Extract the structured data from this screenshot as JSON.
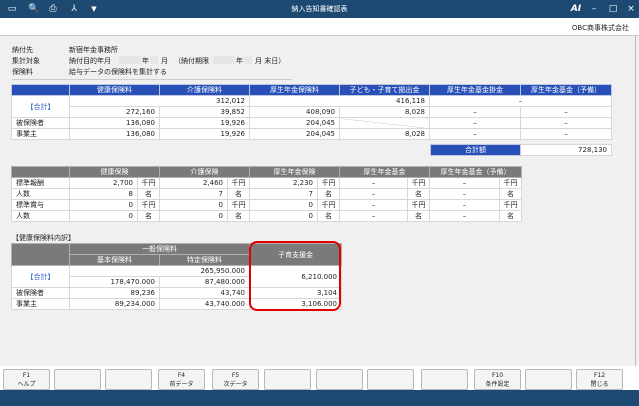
{
  "window": {
    "title": "納入告知書確認表",
    "company": "OBC商事株式会社",
    "minimize": "–",
    "maximize": "□",
    "close": "×"
  },
  "toolbar": {
    "icons": [
      "window-icon",
      "preview-icon",
      "print-icon",
      "pdf-icon",
      "dropdown-icon"
    ]
  },
  "info": {
    "payee_label": "納付先",
    "payee_value": "新宿年金事務所",
    "target_label": "集計対象",
    "target_prefix": "納付目的年月",
    "year_suffix": "年",
    "month_suffix": "月",
    "deadline_prefix": "（納付期限",
    "deadline_suffix": "月 末日）",
    "premium_label": "保険料",
    "premium_value": "給与データの保険料を集計する"
  },
  "table1": {
    "headers": [
      "",
      "健康保険料",
      "介護保険料",
      "厚生年金保険料",
      "子ども・子育て拠出金",
      "厚生年金基金掛金",
      "厚生年金基金（予備）"
    ],
    "total_label": "【合計】",
    "total_health_care": "312,012",
    "total_kodomo": "416,118",
    "total_fund": "–",
    "total_row": [
      "272,160",
      "39,852",
      "408,090",
      "8,028",
      "–",
      "–"
    ],
    "rows": [
      {
        "label": "被保険者",
        "values": [
          "136,080",
          "19,926",
          "204,045",
          "",
          "–",
          "–"
        ]
      },
      {
        "label": "事業主",
        "values": [
          "136,080",
          "19,926",
          "204,045",
          "8,028",
          "–",
          "–"
        ]
      }
    ],
    "grand_total_label": "合計額",
    "grand_total_value": "728,130"
  },
  "table2": {
    "headers": [
      "",
      "健康保険",
      "介護保険",
      "厚生年金保険",
      "厚生年金基金",
      "厚生年金基金（予備）"
    ],
    "rows": [
      {
        "label": "標準報酬",
        "values": [
          "2,700",
          "2,460",
          "2,230",
          "–",
          "–"
        ],
        "unit": "千円"
      },
      {
        "label": "人数",
        "values": [
          "8",
          "7",
          "7",
          "–",
          "–"
        ],
        "unit": "名"
      },
      {
        "label": "標準賞与",
        "values": [
          "0",
          "0",
          "0",
          "–",
          "–"
        ],
        "unit": "千円"
      },
      {
        "label": "人数",
        "values": [
          "0",
          "0",
          "0",
          "–",
          "–"
        ],
        "unit": "名"
      }
    ]
  },
  "table3": {
    "section_title": "【健康保険料内訳】",
    "group_header": "一般保険料",
    "sub_headers": [
      "基本保険料",
      "特定保険料"
    ],
    "child_header": "子育支援金",
    "total_label": "【合計】",
    "total_general": "265,950.000",
    "total_basic": "178,470.000",
    "total_specific": "87,480.000",
    "total_child": "6,210.000",
    "rows": [
      {
        "label": "被保険者",
        "values": [
          "89,236",
          "43,740",
          "3,104"
        ]
      },
      {
        "label": "事業主",
        "values": [
          "89,234.000",
          "43,740.000",
          "3,106.000"
        ]
      }
    ]
  },
  "fkeys": [
    {
      "key": "F1",
      "label": "ヘルプ"
    },
    {
      "key": "",
      "label": ""
    },
    {
      "key": "",
      "label": ""
    },
    {
      "key": "F4",
      "label": "前データ"
    },
    {
      "key": "F5",
      "label": "次データ"
    },
    {
      "key": "",
      "label": ""
    },
    {
      "key": "",
      "label": ""
    },
    {
      "key": "",
      "label": ""
    },
    {
      "key": "",
      "label": ""
    },
    {
      "key": "F10",
      "label": "条件設定"
    },
    {
      "key": "",
      "label": ""
    },
    {
      "key": "F12",
      "label": "閉じる"
    }
  ]
}
